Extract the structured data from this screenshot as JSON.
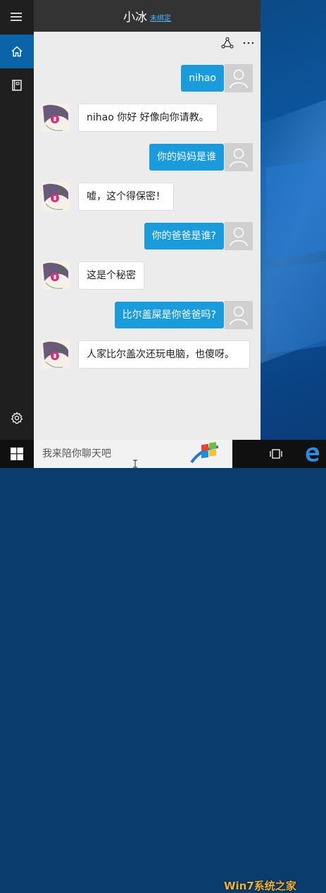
{
  "header": {
    "title": "小冰",
    "subtitle": "未绑定"
  },
  "icons": {
    "menu": "hamburger-icon",
    "home": "home-icon",
    "notebook": "notebook-icon",
    "settings": "gear-icon",
    "share": "share-icon",
    "more": "more-icon",
    "start": "windows-icon",
    "task_view": "task-view-icon",
    "edge": "edge-icon"
  },
  "colors": {
    "accent": "#0b63a8",
    "bubble_user": "#1a9bdc",
    "header": "#333333",
    "sidebar": "#1f1f1f"
  },
  "conversation": [
    {
      "from": "user",
      "text": "nihao"
    },
    {
      "from": "bot",
      "text": "nihao 你好 好像向你请教。"
    },
    {
      "from": "user",
      "text": "你的妈妈是谁"
    },
    {
      "from": "bot",
      "text": "嘘，这个得保密！"
    },
    {
      "from": "user",
      "text": "你的爸爸是谁?"
    },
    {
      "from": "bot",
      "text": "这是个秘密"
    },
    {
      "from": "user",
      "text": "比尔盖屎是你爸爸吗?"
    },
    {
      "from": "bot",
      "text": "人家比尔盖次还玩电脑，也傻呀。"
    }
  ],
  "input": {
    "placeholder": "我来陪你聊天吧",
    "value": ""
  },
  "watermark": "Win7系统之家"
}
